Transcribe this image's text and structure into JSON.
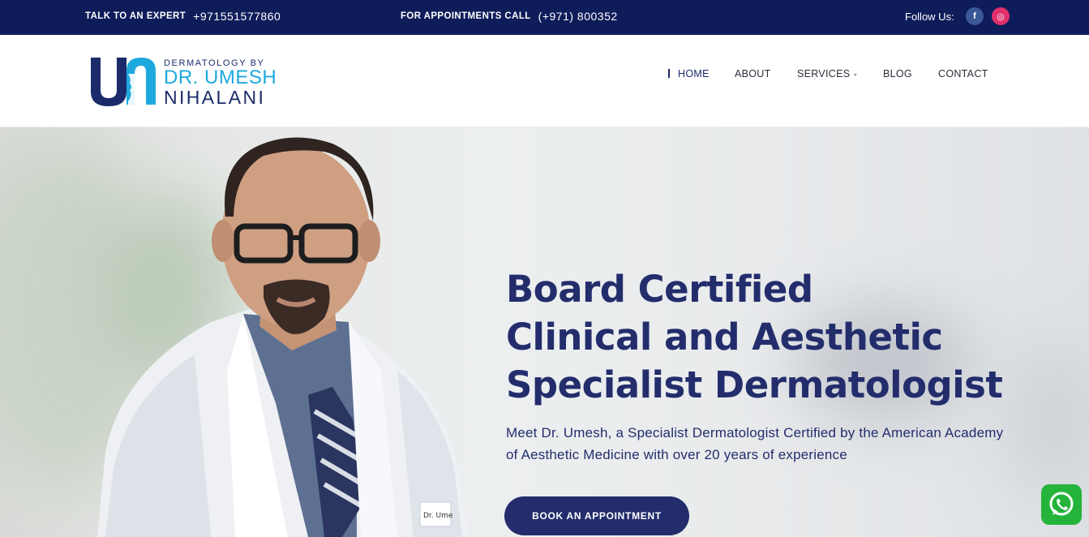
{
  "topbar": {
    "expert_label": "TALK TO AN EXPERT",
    "expert_phone": "+971551577860",
    "appointments_label": "FOR APPOINTMENTS CALL",
    "appointments_phone": "(+971) 800352",
    "follow_label": "Follow Us:",
    "social": [
      {
        "icon": "facebook-icon",
        "glyph": "f",
        "color": "#3b5998"
      },
      {
        "icon": "instagram-icon",
        "glyph": "◎",
        "color": "#e1306c"
      }
    ]
  },
  "logo": {
    "monogram": "un",
    "line1": "DERMATOLOGY BY",
    "line2": "DR. UMESH",
    "line3": "NIHALANI"
  },
  "nav": {
    "items": [
      {
        "label": "HOME",
        "active": true
      },
      {
        "label": "ABOUT"
      },
      {
        "label": "SERVICES",
        "has_dropdown": true
      },
      {
        "label": "BLOG"
      },
      {
        "label": "CONTACT"
      }
    ]
  },
  "hero": {
    "heading_lines": [
      "Board Certified",
      "Clinical and Aesthetic",
      "Specialist Dermatologist"
    ],
    "subtext": "Meet Dr. Umesh, a Specialist Dermatologist Certified by the American Academy of Aesthetic Medicine with over 20 years of experience",
    "cta_label": "BOOK AN APPOINTMENT",
    "badge_text": "Dr. Ume"
  },
  "whatsapp": {
    "icon": "whatsapp-icon"
  },
  "colors": {
    "topbar_bg": "#0e1c5a",
    "brand_navy": "#232d6c",
    "brand_cyan": "#1ea9de",
    "whatsapp_green": "#25b43b"
  }
}
